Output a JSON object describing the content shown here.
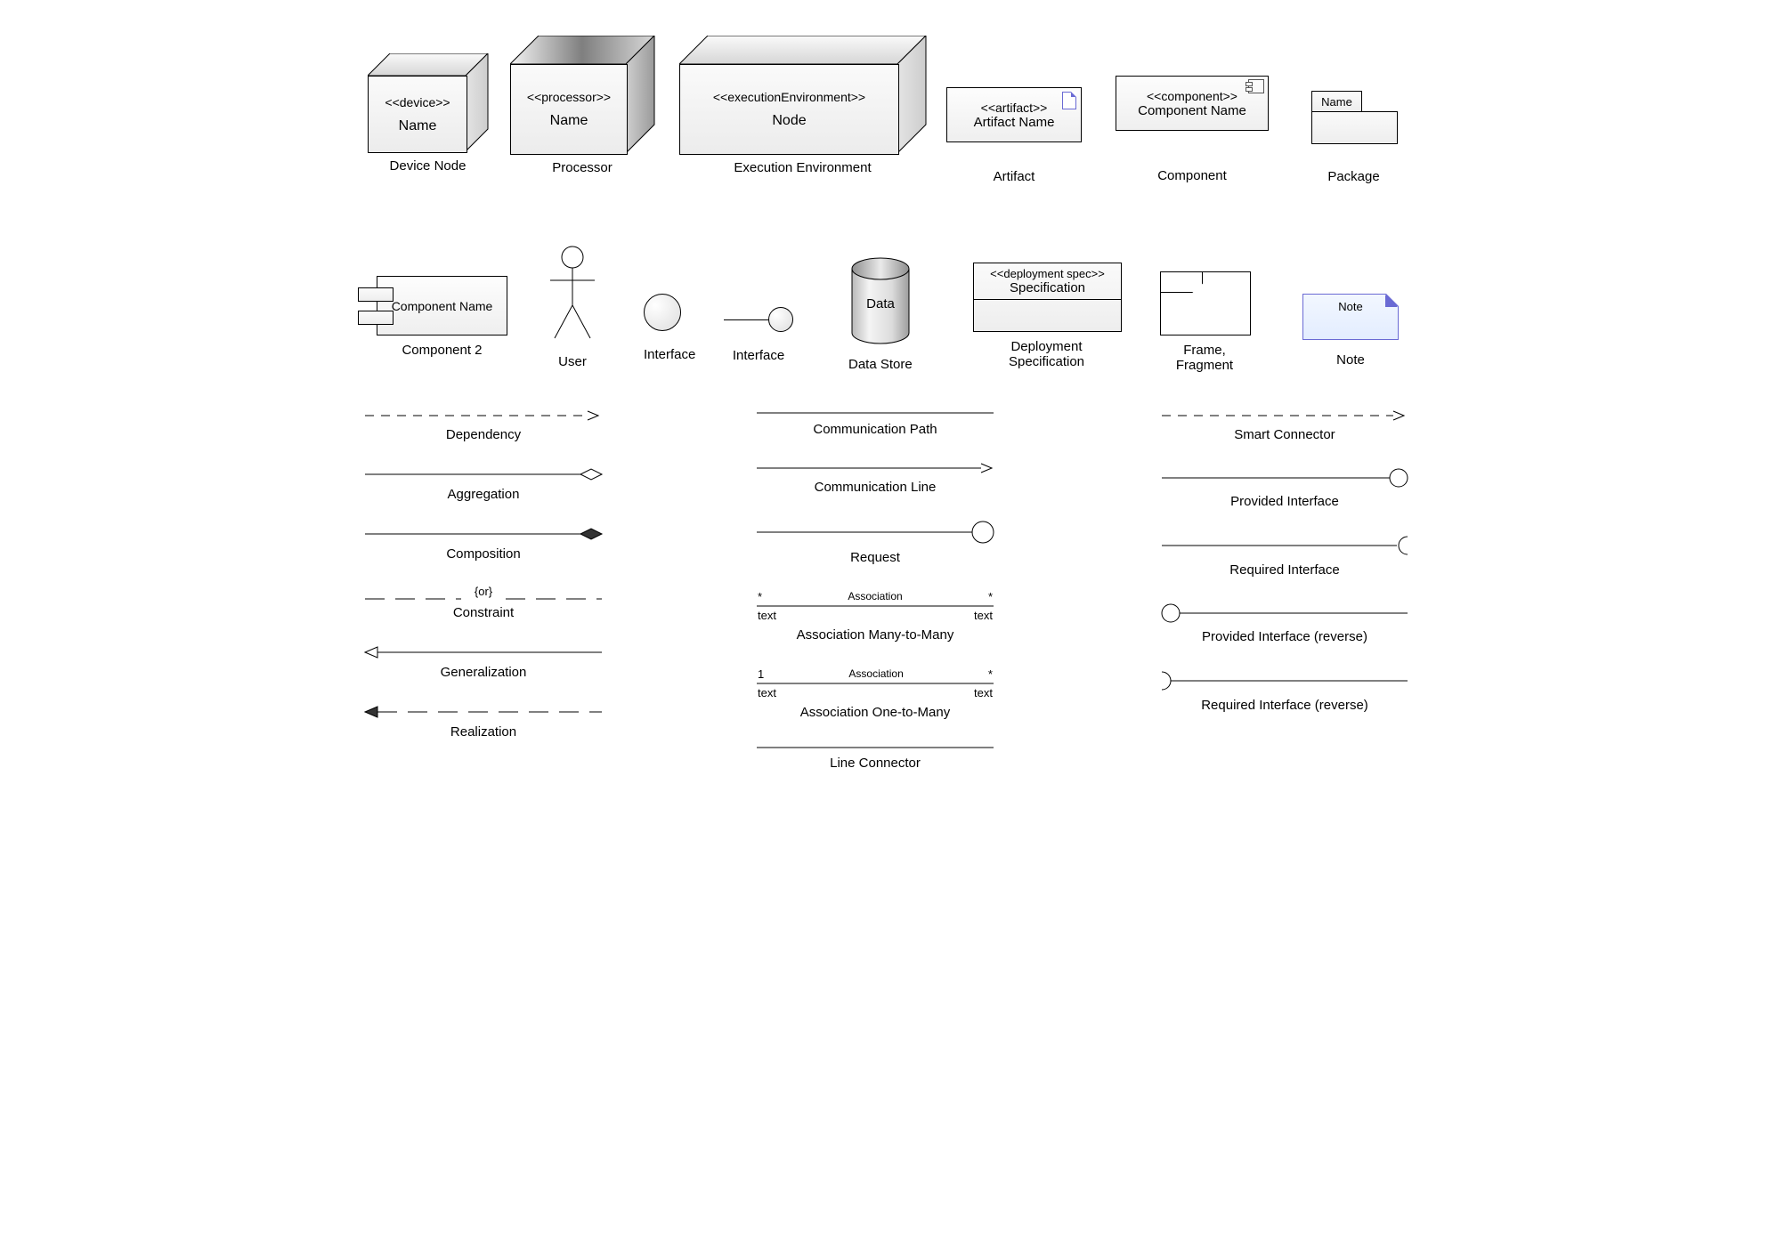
{
  "row1": {
    "device": {
      "stereo": "<<device>>",
      "name": "Name",
      "caption": "Device Node"
    },
    "processor": {
      "stereo": "<<processor>>",
      "name": "Name",
      "caption": "Processor"
    },
    "exec": {
      "stereo": "<<executionEnvironment>>",
      "name": "Node",
      "caption": "Execution Environment"
    },
    "artifact": {
      "stereo": "<<artifact>>",
      "name": "Artifact Name",
      "caption": "Artifact"
    },
    "component": {
      "stereo": "<<component>>",
      "name": "Component Name",
      "caption": "Component"
    },
    "package": {
      "name": "Name",
      "caption": "Package"
    }
  },
  "row2": {
    "component2": {
      "name": "Component Name",
      "caption": "Component 2"
    },
    "user": {
      "caption": "User"
    },
    "interface": {
      "caption": "Interface"
    },
    "interface2": {
      "caption": "Interface"
    },
    "datastore": {
      "name": "Data",
      "caption": "Data Store"
    },
    "dspec": {
      "stereo": "<<deployment spec>>",
      "name": "Specification",
      "caption": "Deployment Specification"
    },
    "frame": {
      "caption": "Frame, Fragment"
    },
    "note": {
      "name": "Note",
      "caption": "Note"
    }
  },
  "connectors": {
    "colA": {
      "dependency": "Dependency",
      "aggregation": "Aggregation",
      "composition": "Composition",
      "constraint_or": "{or}",
      "constraint": "Constraint",
      "generalization": "Generalization",
      "realization": "Realization"
    },
    "colB": {
      "commpath": "Communication Path",
      "commline": "Communication Line",
      "request": "Request",
      "assoc_label": "Association",
      "star": "*",
      "one": "1",
      "text": "text",
      "assocMM": "Association Many-to-Many",
      "assocOM": "Association One-to-Many",
      "lineconn": "Line Connector"
    },
    "colC": {
      "smart": "Smart Connector",
      "provided": "Provided Interface",
      "required": "Required Interface",
      "provided_rev": "Provided Interface (reverse)",
      "required_rev": "Required Interface (reverse)"
    }
  }
}
